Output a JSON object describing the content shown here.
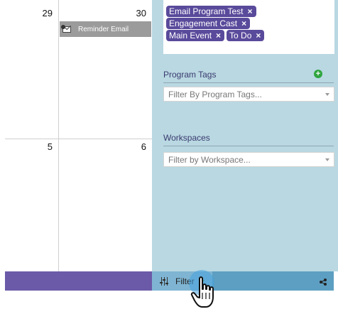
{
  "calendar": {
    "cells": [
      {
        "day": "29"
      },
      {
        "day": "30"
      },
      {
        "day": "5"
      },
      {
        "day": "6"
      }
    ],
    "event": {
      "label": "Reminder Email",
      "icon": "email-program-icon"
    }
  },
  "filters": {
    "selected_tags": [
      {
        "label": "Email Program Test",
        "remove": "×"
      },
      {
        "label": "Engagement Cast",
        "remove": "×"
      },
      {
        "label": "Main Event",
        "remove": "×"
      },
      {
        "label": "To Do",
        "remove": "×"
      }
    ],
    "program_tags": {
      "title": "Program Tags",
      "placeholder": "Filter By Program Tags..."
    },
    "workspaces": {
      "title": "Workspaces",
      "placeholder": "Filter by Workspace..."
    }
  },
  "bottom_bar": {
    "filter_label": "Filter",
    "colors": {
      "left": "#6b5aa8",
      "right": "#5d9fc2"
    }
  },
  "colors": {
    "panel": "#b9d8e2",
    "tag": "#5a4a9b",
    "add": "#2fa53f"
  }
}
